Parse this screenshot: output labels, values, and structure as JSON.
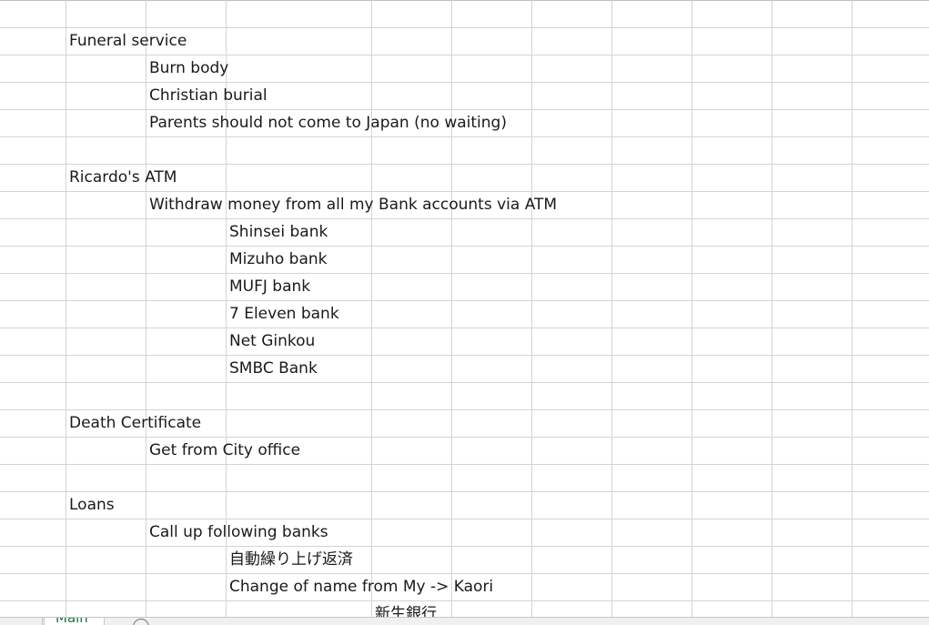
{
  "sheet": {
    "cells": [
      {
        "row": 1,
        "col": 1,
        "text": "Funeral service"
      },
      {
        "row": 2,
        "col": 2,
        "text": "Burn body"
      },
      {
        "row": 3,
        "col": 2,
        "text": "Christian burial"
      },
      {
        "row": 4,
        "col": 2,
        "text": "Parents should not come to Japan (no waiting)"
      },
      {
        "row": 6,
        "col": 1,
        "text": "Ricardo's ATM"
      },
      {
        "row": 7,
        "col": 2,
        "text": "Withdraw money from all my Bank accounts via ATM"
      },
      {
        "row": 8,
        "col": 3,
        "text": "Shinsei bank"
      },
      {
        "row": 9,
        "col": 3,
        "text": "Mizuho bank"
      },
      {
        "row": 10,
        "col": 3,
        "text": "MUFJ bank"
      },
      {
        "row": 11,
        "col": 3,
        "text": "7 Eleven bank"
      },
      {
        "row": 12,
        "col": 3,
        "text": "Net Ginkou"
      },
      {
        "row": 13,
        "col": 3,
        "text": "SMBC Bank"
      },
      {
        "row": 15,
        "col": 1,
        "text": "Death Certificate"
      },
      {
        "row": 16,
        "col": 2,
        "text": "Get from City office"
      },
      {
        "row": 18,
        "col": 1,
        "text": "Loans"
      },
      {
        "row": 19,
        "col": 2,
        "text": "Call up following banks"
      },
      {
        "row": 20,
        "col": 3,
        "text": "自動繰り上げ返済"
      },
      {
        "row": 21,
        "col": 3,
        "text": "Change of name from My ->  Kaori"
      },
      {
        "row": 22,
        "col": 4,
        "text": "新生銀行"
      }
    ]
  },
  "sheet_tabs": {
    "active_label": "Main",
    "add_icon": "plus-circle-icon"
  }
}
